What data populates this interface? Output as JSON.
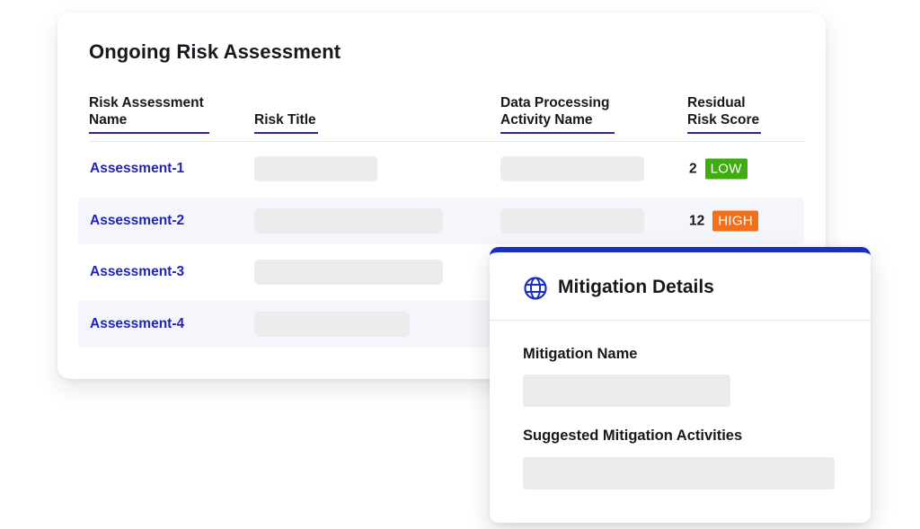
{
  "risk_card": {
    "title": "Ongoing Risk Assessment",
    "columns": {
      "name": "Risk Assessment Name",
      "title": "Risk Title",
      "dpa": "Data Processing Activity Name",
      "score": "Residual Risk Score"
    },
    "rows": [
      {
        "name": "Assessment-1",
        "score": "2",
        "level": "LOW"
      },
      {
        "name": "Assessment-2",
        "score": "12",
        "level": "HIGH"
      },
      {
        "name": "Assessment-3"
      },
      {
        "name": "Assessment-4"
      }
    ]
  },
  "mitigation": {
    "title": "Mitigation Details",
    "icon": "globe-icon",
    "name_label": "Mitigation Name",
    "activities_label": "Suggested Mitigation Activities"
  },
  "colors": {
    "accent": "#2225b3",
    "panel_top_bar": "#1b2ec4",
    "low": "#3fad10",
    "high": "#f2701a",
    "skeleton": "#ececec"
  }
}
